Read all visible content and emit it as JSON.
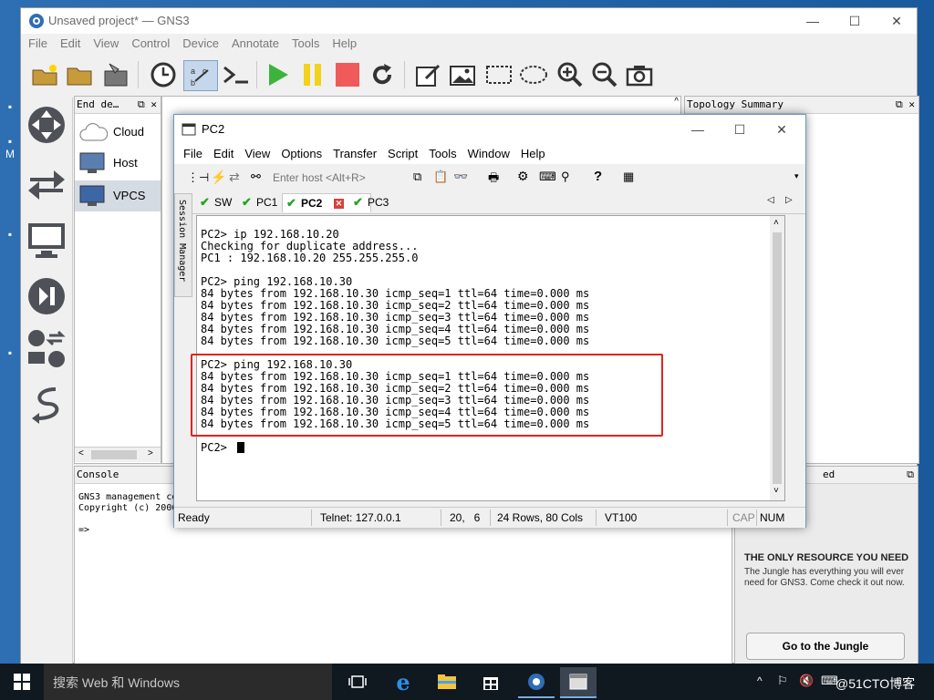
{
  "gns3": {
    "title": "Unsaved project* — GNS3",
    "menu": [
      "File",
      "Edit",
      "View",
      "Control",
      "Device",
      "Annotate",
      "Tools",
      "Help"
    ],
    "device_panel_title": "End de…",
    "devices": [
      "Cloud",
      "Host",
      "VPCS"
    ],
    "topology_title": "Topology Summary",
    "console_title": "Console",
    "console_lines": "GNS3 management co\nCopyright (c) 2006\n\n=>",
    "jungle": {
      "heading_fragment": "ed",
      "heading": "THE ONLY RESOURCE YOU NEED",
      "body": "The Jungle has everything you will ever need for GNS3. Come check it out now.",
      "button": "Go to the Jungle"
    }
  },
  "desktop_edge": {
    "label_m": "M"
  },
  "pc2": {
    "title": "PC2",
    "menu": [
      "File",
      "Edit",
      "View",
      "Options",
      "Transfer",
      "Script",
      "Tools",
      "Window",
      "Help"
    ],
    "host_placeholder": "Enter host <Alt+R>",
    "tabs": [
      "SW",
      "PC1",
      "PC2",
      "PC3"
    ],
    "active_tab": "PC2",
    "session_manager": "Session Manager",
    "terminal": "PC2> ip 192.168.10.20\nChecking for duplicate address...\nPC1 : 192.168.10.20 255.255.255.0\n\nPC2> ping 192.168.10.30\n84 bytes from 192.168.10.30 icmp_seq=1 ttl=64 time=0.000 ms\n84 bytes from 192.168.10.30 icmp_seq=2 ttl=64 time=0.000 ms\n84 bytes from 192.168.10.30 icmp_seq=3 ttl=64 time=0.000 ms\n84 bytes from 192.168.10.30 icmp_seq=4 ttl=64 time=0.000 ms\n84 bytes from 192.168.10.30 icmp_seq=5 ttl=64 time=0.000 ms\n\nPC2> ping 192.168.10.30\n84 bytes from 192.168.10.30 icmp_seq=1 ttl=64 time=0.000 ms\n84 bytes from 192.168.10.30 icmp_seq=2 ttl=64 time=0.000 ms\n84 bytes from 192.168.10.30 icmp_seq=3 ttl=64 time=0.000 ms\n84 bytes from 192.168.10.30 icmp_seq=4 ttl=64 time=0.000 ms\n84 bytes from 192.168.10.30 icmp_seq=5 ttl=64 time=0.000 ms\n\nPC2> ",
    "status": {
      "ready": "Ready",
      "telnet": "Telnet: 127.0.0.1",
      "cursor": "20,   6",
      "size": "24 Rows, 80 Cols",
      "emulation": "VT100",
      "cap": "CAP",
      "num": "NUM"
    }
  },
  "taskbar": {
    "search_placeholder": "搜索 Web 和 Windows",
    "watermark": "@51CTO博客"
  },
  "colors": {
    "highlight_box": "#e0241b",
    "tab_check": "#27a327",
    "taskbar": "#101820"
  }
}
